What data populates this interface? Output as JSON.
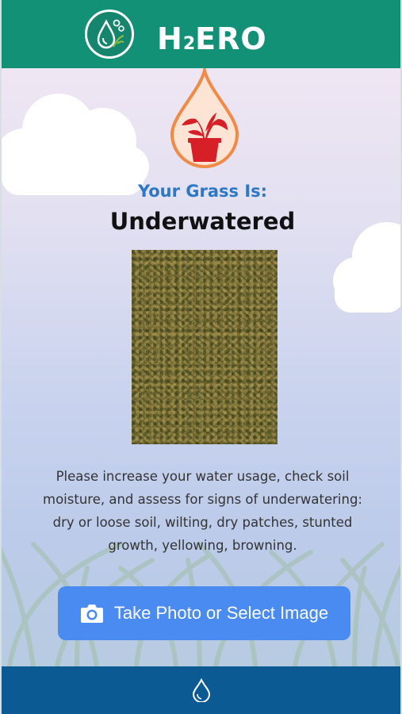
{
  "header": {
    "brand_main": "H",
    "brand_sub": "2",
    "brand_rest": "ERO",
    "logo_icon": "water-drop-leaf-logo-icon"
  },
  "result": {
    "status_icon": "plant-in-drop-icon",
    "label": "Your Grass Is:",
    "value": "Underwatered"
  },
  "advice": "Please increase your water usage, check soil moisture, and assess for signs of underwatering: dry or loose soil, wilting, dry patches, stunted growth, yellowing, browning.",
  "action": {
    "icon": "camera-icon",
    "label": "Take Photo or Select Image"
  },
  "footer": {
    "icon": "water-drop-icon"
  },
  "colors": {
    "header_bg": "#139177",
    "footer_bg": "#0c5a94",
    "button_bg": "#4a8bf2",
    "label_blue": "#2d78c6",
    "drop_orange": "#f08a46",
    "plant_red": "#d61f26"
  }
}
